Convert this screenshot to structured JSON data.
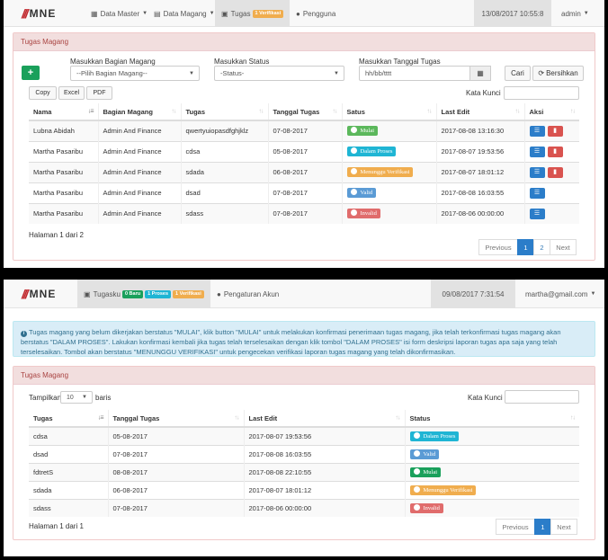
{
  "brand": {
    "name": "MNE"
  },
  "s1": {
    "nav": {
      "data_master": "Data Master",
      "data_magang": "Data Magang",
      "tugas": "Tugas",
      "tugas_badge": "1 Verifikasi",
      "pengguna": "Pengguna"
    },
    "datetime": "13/08/2017 10:55:8",
    "user": "admin",
    "panel_title": "Tugas Magang",
    "filters": {
      "bagian_label": "Masukkan Bagian Magang",
      "bagian_value": "--Pilih Bagian Magang--",
      "status_label": "Masukkan Status",
      "status_value": "-Status-",
      "tanggal_label": "Masukkan Tanggal Tugas",
      "tanggal_placeholder": "hh/bb/tttt",
      "cari": "Cari",
      "bersihkan": "Bersihkan"
    },
    "add_label": "+",
    "export": {
      "copy": "Copy",
      "excel": "Excel",
      "pdf": "PDF"
    },
    "search_label": "Kata Kunci",
    "headers": [
      "Nama",
      "Bagian Magang",
      "Tugas",
      "Tanggal Tugas",
      "Satus",
      "Last Edit",
      "Aksi"
    ],
    "rows": [
      {
        "nama": "Lubna Abidah",
        "bagian": "Admin And Finance",
        "tugas": "qwertyuiopasdfghjklz",
        "tanggal": "07-08-2017",
        "status": "Mulai",
        "last_edit": "2017-08-08 13:16:30"
      },
      {
        "nama": "Martha Pasaribu",
        "bagian": "Admin And Finance",
        "tugas": "cdsa",
        "tanggal": "05-08-2017",
        "status": "Dalam Proses",
        "last_edit": "2017-08-07 19:53:56"
      },
      {
        "nama": "Martha Pasaribu",
        "bagian": "Admin And Finance",
        "tugas": "sdada",
        "tanggal": "06-08-2017",
        "status": "Menunggu Verifikasi",
        "last_edit": "2017-08-07 18:01:12"
      },
      {
        "nama": "Martha Pasaribu",
        "bagian": "Admin And Finance",
        "tugas": "dsad",
        "tanggal": "07-08-2017",
        "status": "Valid",
        "last_edit": "2017-08-08 16:03:55"
      },
      {
        "nama": "Martha Pasaribu",
        "bagian": "Admin And Finance",
        "tugas": "sdass",
        "tanggal": "07-08-2017",
        "status": "Invalid",
        "last_edit": "2017-08-06 00:00:00"
      }
    ],
    "page_info": "Halaman 1 dari 2",
    "pager": {
      "prev": "Previous",
      "p1": "1",
      "p2": "2",
      "next": "Next"
    }
  },
  "s2": {
    "nav": {
      "tugasku": "Tugasku",
      "badge_baru": "0 Baru",
      "badge_proses": "1 Proses",
      "badge_verif": "1 Verifikasi",
      "pengaturan": "Pengaturan Akun"
    },
    "datetime": "09/08/2017 7:31:54",
    "user": "martha@gmail.com",
    "alert": "Tugas magang yang belum dikerjakan berstatus \"MULAI\", klik button \"MULAI\" untuk melakukan konfirmasi penerimaan tugas magang, jika telah terkonfirmasi tugas magang akan berstatus \"DALAM PROSES\". Lakukan konfirmasi kembali jika tugas telah terselesaikan dengan klik tombol \"DALAM PROSES\" isi form deskripsi laporan tugas apa saja yang telah terselesaikan. Tombol akan berstatus \"MENUNGGU VERIFIKASI\" untuk pengecekan verifikasi laporan tugas magang yang telah dikonfirmasikan.",
    "panel_title": "Tugas Magang",
    "show_label": "Tampilkan",
    "show_value": "10",
    "show_suffix": "baris",
    "search_label": "Kata Kunci",
    "headers": [
      "Tugas",
      "Tanggal Tugas",
      "Last Edit",
      "Status"
    ],
    "rows": [
      {
        "tugas": "cdsa",
        "tanggal": "05-08-2017",
        "last_edit": "2017-08-07 19:53:56",
        "status": "Dalam Proses"
      },
      {
        "tugas": "dsad",
        "tanggal": "07-08-2017",
        "last_edit": "2017-08-08 16:03:55",
        "status": "Valid"
      },
      {
        "tugas": "fdtretS",
        "tanggal": "08-08-2017",
        "last_edit": "2017-08-08 22:10:55",
        "status": "Mulai"
      },
      {
        "tugas": "sdada",
        "tanggal": "06-08-2017",
        "last_edit": "2017-08-07 18:01:12",
        "status": "Menunggu Verifikasi"
      },
      {
        "tugas": "sdass",
        "tanggal": "07-08-2017",
        "last_edit": "2017-08-06 00:00:00",
        "status": "Invalid"
      }
    ],
    "page_info": "Halaman 1 dari 1",
    "pager": {
      "prev": "Previous",
      "p1": "1",
      "next": "Next"
    }
  },
  "colors": {
    "mulai": "#5cb85c",
    "dalam_proses": "#1fb5d4",
    "menunggu": "#f0ad4e",
    "valid": "#5b9bd5",
    "invalid": "#e06c6c",
    "panel_head": "#f2dede",
    "primary": "#2b7dc9"
  },
  "icons": {
    "status_icon": "circle-icon",
    "detail": "list-icon",
    "delete": "trash-icon",
    "calendar": "calendar-icon",
    "refresh": "refresh-icon"
  }
}
